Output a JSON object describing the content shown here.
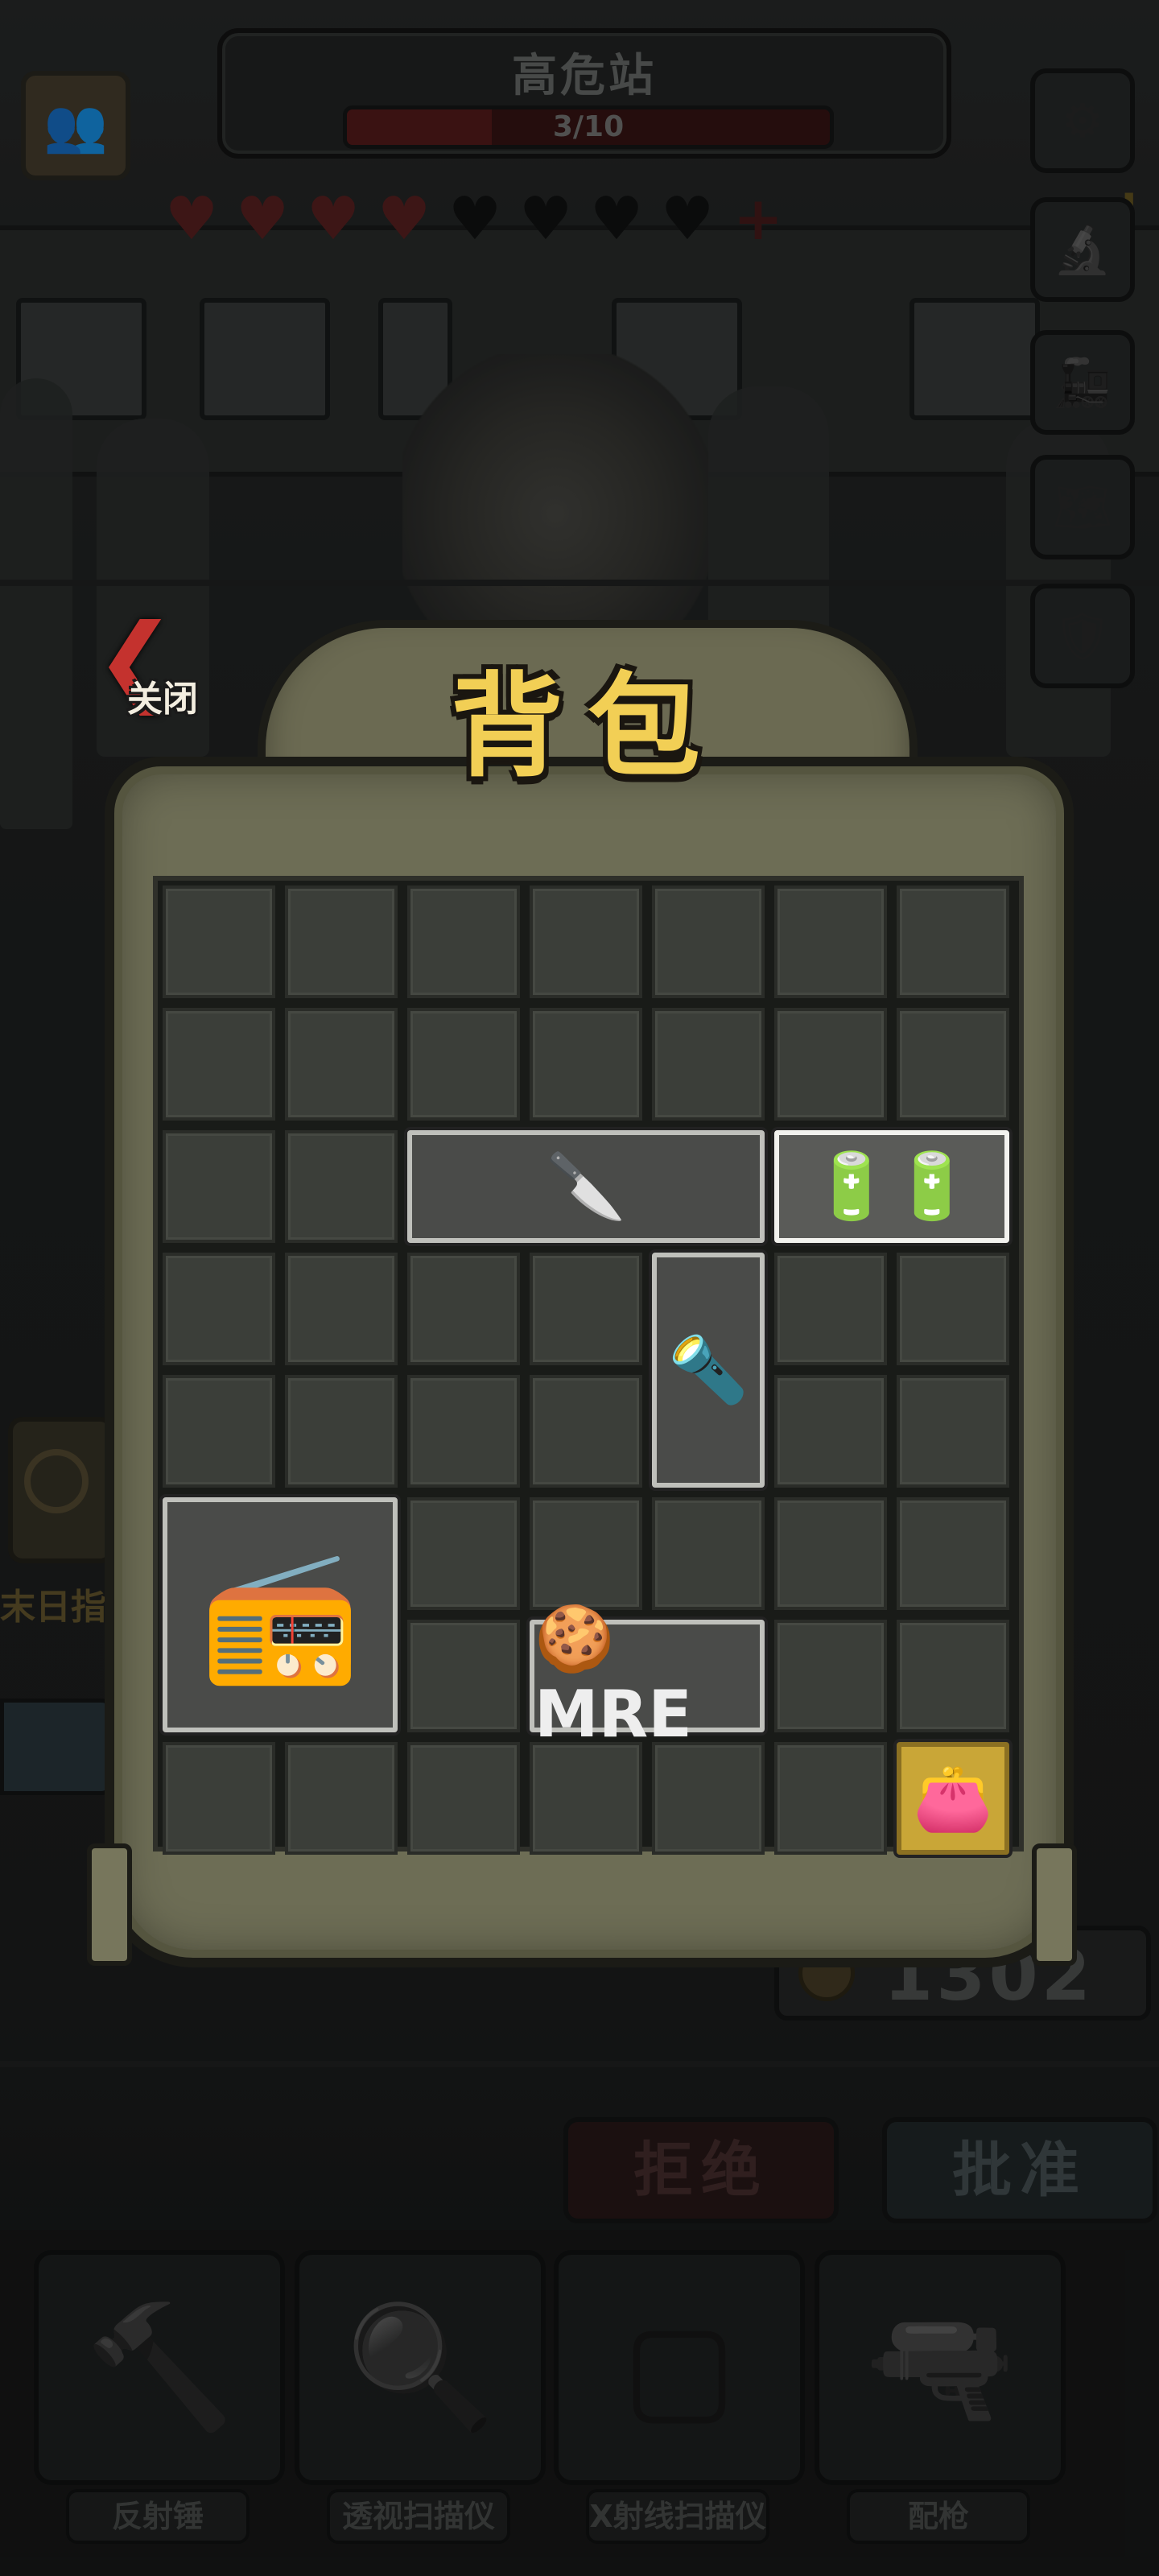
{
  "station": {
    "name": "高危站",
    "progress_text": "3/10",
    "progress": 0.3
  },
  "hearts": {
    "filled": 4,
    "empty": 4,
    "add_symbol": "+"
  },
  "side_buttons": [
    {
      "name": "settings-gear-icon",
      "glyph": "⚙"
    },
    {
      "name": "microscope-icon",
      "glyph": "🔬"
    },
    {
      "name": "train-icon",
      "glyph": "🚂"
    },
    {
      "name": "map-icon",
      "glyph": "🗺"
    },
    {
      "name": "badge-icon",
      "glyph": "🛡"
    }
  ],
  "alert_mark": "!",
  "left_partial_label": "末日指",
  "backpack": {
    "title": "背包",
    "close_label": "关闭",
    "rows": 8,
    "cols": 7,
    "items": [
      {
        "name": "knife-item",
        "icon": "knife-icon",
        "glyph": "🔪",
        "row": 2,
        "col": 2,
        "w": 3,
        "h": 1,
        "selected": false
      },
      {
        "name": "battery-pack-item",
        "icon": "battery-icon",
        "glyph": "🔋🔋",
        "row": 2,
        "col": 5,
        "w": 2,
        "h": 1,
        "selected": true
      },
      {
        "name": "flashlight-item",
        "icon": "flashlight-icon",
        "glyph": "🔦",
        "row": 3,
        "col": 4,
        "w": 1,
        "h": 2,
        "selected": false
      },
      {
        "name": "radio-item",
        "icon": "radio-icon",
        "glyph": "📻",
        "row": 5,
        "col": 0,
        "w": 2,
        "h": 2,
        "selected": false
      },
      {
        "name": "mre-ration-item",
        "icon": "mre-icon",
        "glyph": "🍪 MRE",
        "row": 6,
        "col": 3,
        "w": 2,
        "h": 1,
        "selected": false
      },
      {
        "name": "wallet-item",
        "icon": "wallet-icon",
        "glyph": "👛",
        "row": 7,
        "col": 6,
        "w": 1,
        "h": 1,
        "selected": false,
        "gold": true
      }
    ]
  },
  "coins": {
    "value": "1302"
  },
  "actions": {
    "reject": "拒绝",
    "approve": "批准"
  },
  "tools": [
    {
      "label": "反射锤",
      "icon": "hammer-icon",
      "glyph": "🔨"
    },
    {
      "label": "透视扫描仪",
      "icon": "magnifier-icon",
      "glyph": "🔍"
    },
    {
      "label": "X射线扫描仪",
      "icon": "xray-scanner-icon",
      "glyph": "▢"
    },
    {
      "label": "配枪",
      "icon": "pistol-icon",
      "glyph": "🔫"
    }
  ],
  "tool_prev_glyph": "‹"
}
